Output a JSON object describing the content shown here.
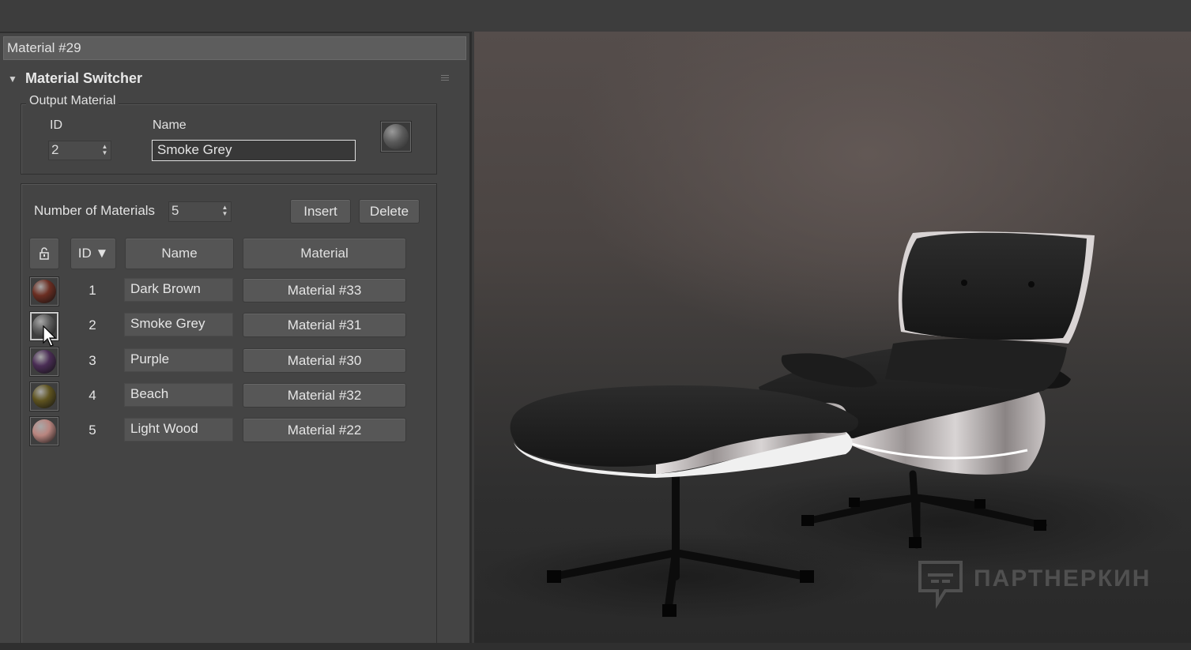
{
  "material_editor": {
    "material_name": "Material #29",
    "rollout": {
      "title": "Material Switcher"
    },
    "output_material": {
      "legend": "Output Material",
      "id_label": "ID",
      "id_value": "2",
      "name_label": "Name",
      "name_value": "Smoke Grey"
    },
    "list": {
      "count_label": "Number of Materials",
      "count_value": "5",
      "insert_label": "Insert",
      "delete_label": "Delete",
      "headers": {
        "id": "ID ▼",
        "name": "Name",
        "material": "Material"
      },
      "rows": [
        {
          "id": "1",
          "name": "Dark Brown",
          "material": "Material #33",
          "color": "#6b2e22"
        },
        {
          "id": "2",
          "name": "Smoke Grey",
          "material": "Material #31",
          "color": "#5e5e5e"
        },
        {
          "id": "3",
          "name": "Purple",
          "material": "Material #30",
          "color": "#4a2d55"
        },
        {
          "id": "4",
          "name": "Beach",
          "material": "Material #32",
          "color": "#5f5420"
        },
        {
          "id": "5",
          "name": "Light Wood",
          "material": "Material #22",
          "color": "#b9857f"
        }
      ]
    }
  },
  "viewport": {
    "watermark": "ПАРТНЕРКИН"
  },
  "icons": [
    "collapse-arrow-icon",
    "rollout-grip-icon",
    "spinner-arrows-icon",
    "lock-icon",
    "mouse-cursor-icon",
    "watermark-logo-icon"
  ]
}
